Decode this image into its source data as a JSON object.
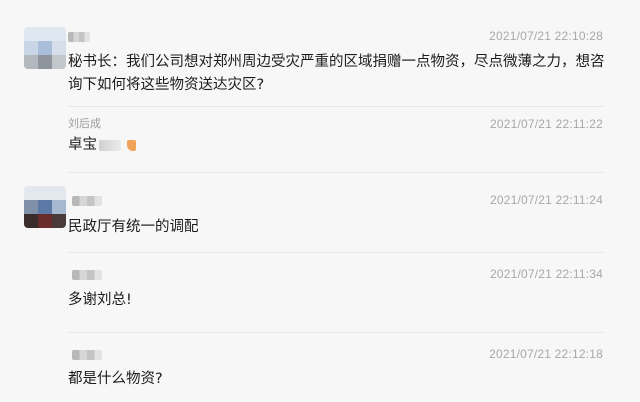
{
  "messages": [
    {
      "time": "2021/07/21 22:10:28",
      "text": "秘书长：我们公司想对郑州周边受灾严重的区域捐赠一点物资，尽点微薄之力，想咨询下如何将这些物资送达灾区?"
    },
    {
      "name": "刘后成",
      "time": "2021/07/21 22:11:22",
      "text": "卓宝"
    },
    {
      "time": "2021/07/21 22:11:24",
      "text": "民政厅有统一的调配"
    },
    {
      "time": "2021/07/21 22:11:34",
      "text": "多谢刘总!"
    },
    {
      "time": "2021/07/21 22:12:18",
      "text": "都是什么物资?"
    }
  ]
}
